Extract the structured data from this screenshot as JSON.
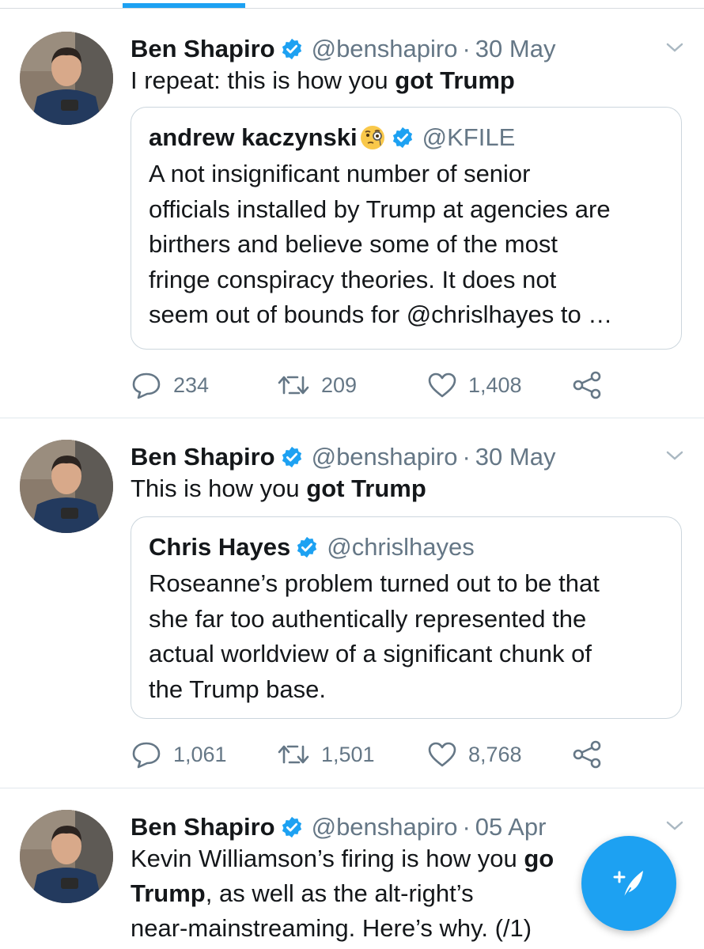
{
  "tweets": [
    {
      "name": "Ben Shapiro",
      "handle": "@benshapiro",
      "dot": "·",
      "date": "30 May",
      "text_plain": "I repeat: this is how you ",
      "text_bold": "got Trump",
      "quote": {
        "name": "andrew kaczynski",
        "emoji_icon": "face-with-monocle-emoji",
        "handle": "@KFILE",
        "lines": [
          "A not insignificant number of senior",
          "officials installed by Trump at agencies are",
          "birthers and believe some of the most",
          "fringe conspiracy theories. It does not",
          "seem out of bounds for @chrislhayes to …"
        ]
      },
      "replies": "234",
      "retweets": "209",
      "likes": "1,408"
    },
    {
      "name": "Ben Shapiro",
      "handle": "@benshapiro",
      "dot": "·",
      "date": "30 May",
      "text_plain": "This is how you ",
      "text_bold": "got Trump",
      "quote": {
        "name": "Chris Hayes",
        "handle": "@chrislhayes",
        "lines": [
          "Roseanne’s problem turned out to be that",
          "she far too authentically represented the",
          "actual worldview of a significant chunk of",
          "the Trump base."
        ]
      },
      "replies": "1,061",
      "retweets": "1,501",
      "likes": "8,768"
    },
    {
      "name": "Ben Shapiro",
      "handle": "@benshapiro",
      "dot": "·",
      "date": "05 Apr",
      "line1_plain": "Kevin Williamson’s firing is how you ",
      "line1_bold": "go",
      "line2_bold": "Trump",
      "line2_plain": ", as well as the alt-right’s",
      "line3": "near-mainstreaming. Here’s why. (/1)"
    }
  ],
  "icons": {
    "verified": "verified-badge-icon",
    "reply": "reply-icon",
    "retweet": "retweet-icon",
    "like": "heart-icon",
    "share": "share-icon",
    "menu": "chevron-down-icon",
    "compose": "compose-tweet-icon"
  },
  "colors": {
    "accent": "#1da1f2",
    "text": "#14171a",
    "secondary": "#657786",
    "border": "#ccd6dd"
  }
}
